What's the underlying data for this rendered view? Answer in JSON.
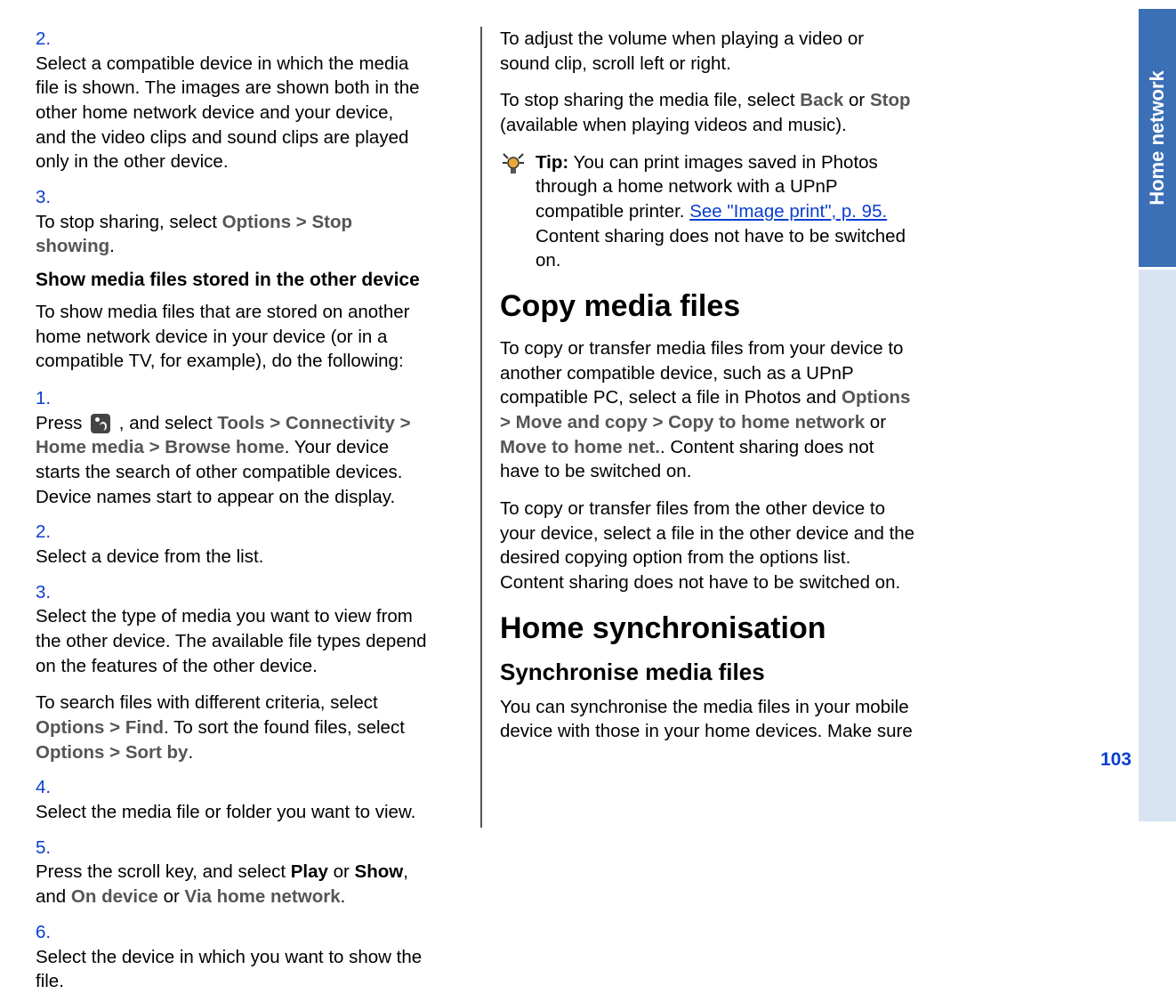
{
  "sideTab": "Home network",
  "pageNumber": "103",
  "left": {
    "list1": [
      {
        "n": "2.",
        "t": "Select a compatible device in which the media file is shown. The images are shown both in the other home network device and your device, and the video clips and sound clips are played only in the other device."
      },
      {
        "n": "3.",
        "t_pre": "To stop sharing, select ",
        "m1": "Options",
        "sep1": " > ",
        "m2": "Stop showing",
        "t_post": "."
      }
    ],
    "subhead": "Show media files stored in the other device",
    "intro": "To show media files that are stored on another home network device in your device (or in a compatible TV, for example), do the following:",
    "list2": [
      {
        "n": "1.",
        "pre": "Press ",
        "icon": true,
        "mid": " , and select ",
        "chain": [
          "Tools",
          "Connectivity",
          "Home media",
          "Browse home"
        ],
        "post": ". Your device starts the search of other compatible devices. Device names start to appear on the display."
      },
      {
        "n": "2.",
        "t": "Select a device from the list."
      },
      {
        "n": "3.",
        "t": "Select the type of media you want to view from the other device. The available file types depend on the features of the other device.",
        "indent_pre": "To search files with different criteria, select ",
        "i_m1": "Options",
        "i_s1": " > ",
        "i_m2": "Find",
        "i_mid": ". To sort the found files, select ",
        "i_m3": "Options",
        "i_s2": " > ",
        "i_m4": "Sort by",
        "i_post": "."
      },
      {
        "n": "4.",
        "t": "Select the media file or folder you want to view."
      },
      {
        "n": "5.",
        "pre": "Press the scroll key, and select ",
        "m1": "Play",
        "mid1": " or ",
        "m2": "Show",
        "mid2": ", and ",
        "m3": "On device",
        "mid3": " or ",
        "m4": "Via home network",
        "post": "."
      },
      {
        "n": "6.",
        "t": "Select the device in which you want to show the file."
      }
    ]
  },
  "right": {
    "p1": "To adjust the volume when playing a video or sound clip, scroll left or right.",
    "p2_pre": "To stop sharing the media file, select ",
    "p2_m1": "Back",
    "p2_mid": " or ",
    "p2_m2": "Stop",
    "p2_post": " (available when playing videos and music).",
    "tip_label": "Tip:",
    "tip_pre": " You can print images saved in Photos through a home network with a UPnP compatible printer. ",
    "tip_link": "See \"Image print\", p. 95.",
    "tip_post": " Content sharing does not have to be switched on.",
    "h1a": "Copy media files",
    "p3_pre": "To copy or transfer media files from your device to another compatible device, such as a UPnP compatible PC, select a file in Photos and ",
    "p3_m1": "Options",
    "p3_s1": " > ",
    "p3_m2": "Move and copy",
    "p3_s2": " > ",
    "p3_m3": "Copy to home network",
    "p3_mid": " or ",
    "p3_m4": "Move to home net.",
    "p3_post": ". Content sharing does not have to be switched on.",
    "p4": "To copy or transfer files from the other device to your device, select a file in the other device and the desired copying option from the options list. Content sharing does not have to be switched on.",
    "h1b": "Home synchronisation",
    "h2a": "Synchronise media files",
    "p5": "You can synchronise the media files in your mobile device with those in your home devices. Make sure"
  }
}
